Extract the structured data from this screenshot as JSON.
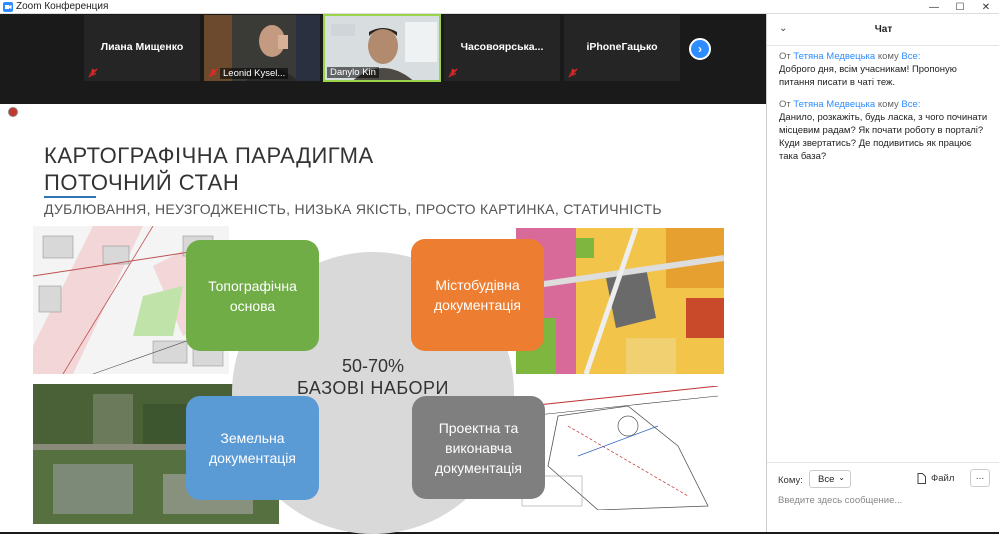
{
  "window": {
    "title": "Zoom Конференция"
  },
  "participants": [
    {
      "name": "Лиана Мищенко",
      "label": ""
    },
    {
      "name": "",
      "label": "Leonid Kysel..."
    },
    {
      "name": "",
      "label": "Danylo Kin"
    },
    {
      "name": "Часовоярська...",
      "label": ""
    },
    {
      "name": "iPhoneГацько",
      "label": ""
    }
  ],
  "slide": {
    "title_line1": "КАРТОГРАФІЧНА ПАРАДИГМА",
    "title_line2": "ПОТОЧНИЙ СТАН",
    "subtitle": "ДУБЛЮВАННЯ, НЕУЗГОДЖЕНІСТЬ, НИЗЬКА ЯКІСТЬ, ПРОСТО КАРТИНКА, СТАТИЧНІСТЬ",
    "center_percent": "50-70%",
    "center_label": "БАЗОВІ НАБОРИ",
    "cards": [
      {
        "text": "Топографічна основа",
        "color": "#70ad47"
      },
      {
        "text": "Містобудівна документація",
        "color": "#ed7d31"
      },
      {
        "text": "Земельна документація",
        "color": "#5b9bd5"
      },
      {
        "text": "Проектна та виконавча документація",
        "color": "#7f7f7f"
      }
    ]
  },
  "chat": {
    "title": "Чат",
    "messages": [
      {
        "from_prefix": "От",
        "from": "Тетяна Медвецька",
        "to_prefix": "кому",
        "to": "Все:",
        "text": "Доброго дня, всім учасникам! Пропоную питання писати в чаті теж."
      },
      {
        "from_prefix": "От",
        "from": "Тетяна Медвецька",
        "to_prefix": "кому",
        "to": "Все:",
        "text": "Данило, розкажіть, будь ласка, з чого починати місцевим радам? Як почати роботу в порталі? Куди звертатись?   Де подивитись як працює така база?"
      }
    ],
    "to_label": "Кому:",
    "to_value": "Все",
    "file_label": "Файл",
    "more_label": "...",
    "input_placeholder": "Введите здесь сообщение..."
  },
  "colors": {
    "zoom_blue": "#2d8cff",
    "active_speaker": "#9bd34b",
    "mic_muted": "#e02828"
  }
}
